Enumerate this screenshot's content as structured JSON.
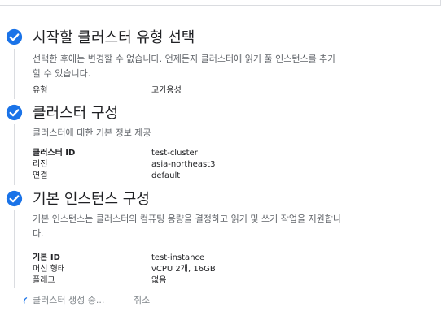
{
  "steps": [
    {
      "title": "시작할 클러스터 유형 선택",
      "desc_line1": "선택한 후에는 변경할 수 없습니다. 언제든지 클러스터에 읽기 풀 인스턴스를 추가",
      "desc_line2": "할 수 있습니다.",
      "fields": [
        {
          "key": "유형",
          "value": "고가용성"
        }
      ]
    },
    {
      "title": "클러스터 구성",
      "desc_line1": "클러스터에 대한 기본 정보 제공",
      "fields": [
        {
          "key": "클러스터 ID",
          "value": "test-cluster"
        },
        {
          "key": "리전",
          "value": "asia-northeast3"
        },
        {
          "key": "연결",
          "value": "default"
        }
      ]
    },
    {
      "title": "기본 인스턴스 구성",
      "desc_line1": "기본 인스턴스는 클러스터의 컴퓨팅 용량을 결정하고 읽기 및 쓰기 작업을 지원합니",
      "desc_line2": "다.",
      "fields": [
        {
          "key": "기본 ID",
          "value": "test-instance"
        },
        {
          "key": "머신 형태",
          "value": "vCPU 2개, 16GB"
        },
        {
          "key": "플래그",
          "value": "없음"
        }
      ]
    }
  ],
  "footer": {
    "status": "클러스터 생성 중...",
    "cancel": "취소"
  },
  "colors": {
    "check": "#1a73e8",
    "line": "#dadce0",
    "muted": "#5f6368"
  },
  "icons": {
    "step_complete": "check-circle-icon",
    "spinner": "progress-spinner-icon"
  }
}
